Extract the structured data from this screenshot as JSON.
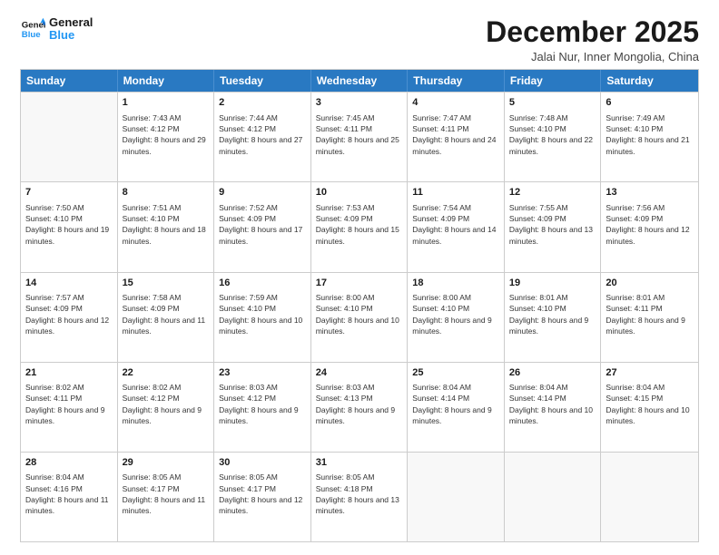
{
  "logo": {
    "line1": "General",
    "line2": "Blue"
  },
  "title": "December 2025",
  "subtitle": "Jalai Nur, Inner Mongolia, China",
  "days": [
    "Sunday",
    "Monday",
    "Tuesday",
    "Wednesday",
    "Thursday",
    "Friday",
    "Saturday"
  ],
  "rows": [
    [
      {
        "day": "",
        "empty": true
      },
      {
        "day": "1",
        "sunrise": "Sunrise: 7:43 AM",
        "sunset": "Sunset: 4:12 PM",
        "daylight": "Daylight: 8 hours and 29 minutes."
      },
      {
        "day": "2",
        "sunrise": "Sunrise: 7:44 AM",
        "sunset": "Sunset: 4:12 PM",
        "daylight": "Daylight: 8 hours and 27 minutes."
      },
      {
        "day": "3",
        "sunrise": "Sunrise: 7:45 AM",
        "sunset": "Sunset: 4:11 PM",
        "daylight": "Daylight: 8 hours and 25 minutes."
      },
      {
        "day": "4",
        "sunrise": "Sunrise: 7:47 AM",
        "sunset": "Sunset: 4:11 PM",
        "daylight": "Daylight: 8 hours and 24 minutes."
      },
      {
        "day": "5",
        "sunrise": "Sunrise: 7:48 AM",
        "sunset": "Sunset: 4:10 PM",
        "daylight": "Daylight: 8 hours and 22 minutes."
      },
      {
        "day": "6",
        "sunrise": "Sunrise: 7:49 AM",
        "sunset": "Sunset: 4:10 PM",
        "daylight": "Daylight: 8 hours and 21 minutes."
      }
    ],
    [
      {
        "day": "7",
        "sunrise": "Sunrise: 7:50 AM",
        "sunset": "Sunset: 4:10 PM",
        "daylight": "Daylight: 8 hours and 19 minutes."
      },
      {
        "day": "8",
        "sunrise": "Sunrise: 7:51 AM",
        "sunset": "Sunset: 4:10 PM",
        "daylight": "Daylight: 8 hours and 18 minutes."
      },
      {
        "day": "9",
        "sunrise": "Sunrise: 7:52 AM",
        "sunset": "Sunset: 4:09 PM",
        "daylight": "Daylight: 8 hours and 17 minutes."
      },
      {
        "day": "10",
        "sunrise": "Sunrise: 7:53 AM",
        "sunset": "Sunset: 4:09 PM",
        "daylight": "Daylight: 8 hours and 15 minutes."
      },
      {
        "day": "11",
        "sunrise": "Sunrise: 7:54 AM",
        "sunset": "Sunset: 4:09 PM",
        "daylight": "Daylight: 8 hours and 14 minutes."
      },
      {
        "day": "12",
        "sunrise": "Sunrise: 7:55 AM",
        "sunset": "Sunset: 4:09 PM",
        "daylight": "Daylight: 8 hours and 13 minutes."
      },
      {
        "day": "13",
        "sunrise": "Sunrise: 7:56 AM",
        "sunset": "Sunset: 4:09 PM",
        "daylight": "Daylight: 8 hours and 12 minutes."
      }
    ],
    [
      {
        "day": "14",
        "sunrise": "Sunrise: 7:57 AM",
        "sunset": "Sunset: 4:09 PM",
        "daylight": "Daylight: 8 hours and 12 minutes."
      },
      {
        "day": "15",
        "sunrise": "Sunrise: 7:58 AM",
        "sunset": "Sunset: 4:09 PM",
        "daylight": "Daylight: 8 hours and 11 minutes."
      },
      {
        "day": "16",
        "sunrise": "Sunrise: 7:59 AM",
        "sunset": "Sunset: 4:10 PM",
        "daylight": "Daylight: 8 hours and 10 minutes."
      },
      {
        "day": "17",
        "sunrise": "Sunrise: 8:00 AM",
        "sunset": "Sunset: 4:10 PM",
        "daylight": "Daylight: 8 hours and 10 minutes."
      },
      {
        "day": "18",
        "sunrise": "Sunrise: 8:00 AM",
        "sunset": "Sunset: 4:10 PM",
        "daylight": "Daylight: 8 hours and 9 minutes."
      },
      {
        "day": "19",
        "sunrise": "Sunrise: 8:01 AM",
        "sunset": "Sunset: 4:10 PM",
        "daylight": "Daylight: 8 hours and 9 minutes."
      },
      {
        "day": "20",
        "sunrise": "Sunrise: 8:01 AM",
        "sunset": "Sunset: 4:11 PM",
        "daylight": "Daylight: 8 hours and 9 minutes."
      }
    ],
    [
      {
        "day": "21",
        "sunrise": "Sunrise: 8:02 AM",
        "sunset": "Sunset: 4:11 PM",
        "daylight": "Daylight: 8 hours and 9 minutes."
      },
      {
        "day": "22",
        "sunrise": "Sunrise: 8:02 AM",
        "sunset": "Sunset: 4:12 PM",
        "daylight": "Daylight: 8 hours and 9 minutes."
      },
      {
        "day": "23",
        "sunrise": "Sunrise: 8:03 AM",
        "sunset": "Sunset: 4:12 PM",
        "daylight": "Daylight: 8 hours and 9 minutes."
      },
      {
        "day": "24",
        "sunrise": "Sunrise: 8:03 AM",
        "sunset": "Sunset: 4:13 PM",
        "daylight": "Daylight: 8 hours and 9 minutes."
      },
      {
        "day": "25",
        "sunrise": "Sunrise: 8:04 AM",
        "sunset": "Sunset: 4:14 PM",
        "daylight": "Daylight: 8 hours and 9 minutes."
      },
      {
        "day": "26",
        "sunrise": "Sunrise: 8:04 AM",
        "sunset": "Sunset: 4:14 PM",
        "daylight": "Daylight: 8 hours and 10 minutes."
      },
      {
        "day": "27",
        "sunrise": "Sunrise: 8:04 AM",
        "sunset": "Sunset: 4:15 PM",
        "daylight": "Daylight: 8 hours and 10 minutes."
      }
    ],
    [
      {
        "day": "28",
        "sunrise": "Sunrise: 8:04 AM",
        "sunset": "Sunset: 4:16 PM",
        "daylight": "Daylight: 8 hours and 11 minutes."
      },
      {
        "day": "29",
        "sunrise": "Sunrise: 8:05 AM",
        "sunset": "Sunset: 4:17 PM",
        "daylight": "Daylight: 8 hours and 11 minutes."
      },
      {
        "day": "30",
        "sunrise": "Sunrise: 8:05 AM",
        "sunset": "Sunset: 4:17 PM",
        "daylight": "Daylight: 8 hours and 12 minutes."
      },
      {
        "day": "31",
        "sunrise": "Sunrise: 8:05 AM",
        "sunset": "Sunset: 4:18 PM",
        "daylight": "Daylight: 8 hours and 13 minutes."
      },
      {
        "day": "",
        "empty": true
      },
      {
        "day": "",
        "empty": true
      },
      {
        "day": "",
        "empty": true
      }
    ]
  ]
}
